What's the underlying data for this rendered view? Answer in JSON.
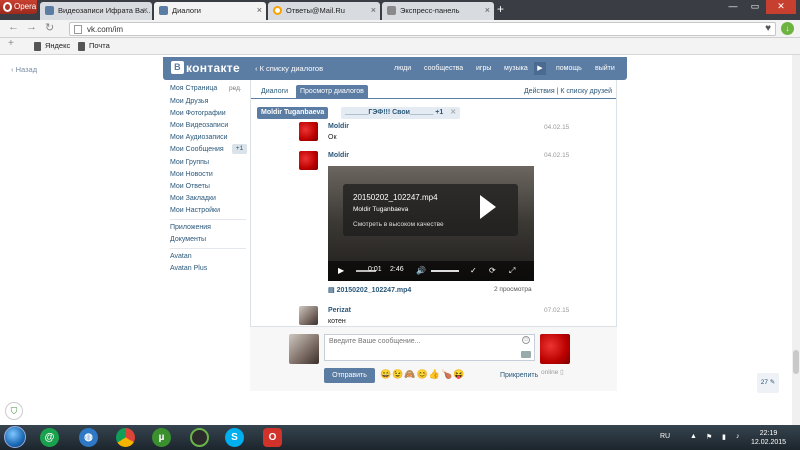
{
  "browser": {
    "menu_label": "Opera",
    "tabs": [
      {
        "title": "Видеозаписи Ифрата Ва...",
        "color": "#5b7ca3"
      },
      {
        "title": "Диалоги",
        "color": "#5b7ca3"
      },
      {
        "title": "Ответы@Mail.Ru",
        "color": "#f7a200"
      },
      {
        "title": "Экспресс-панель",
        "color": "#8a8a8a"
      }
    ],
    "new_tab_glyph": "+",
    "url": "vk.com/im",
    "bookmarks": [
      "Яндекс",
      "Почта"
    ]
  },
  "page": {
    "back_label": "Назад",
    "logo_text": "контакте",
    "logo_letter": "В",
    "back_to_dialogs": "К списку диалогов",
    "top_nav": [
      "люди",
      "сообщества",
      "игры",
      "музыка",
      "помощь",
      "выйти"
    ],
    "left_menu": [
      "Моя Страница",
      "Мои Друзья",
      "Мои Фотографии",
      "Мои Видеозаписи",
      "Мои Аудиозаписи",
      "Мои Сообщения",
      "Мои Группы",
      "Мои Новости",
      "Мои Ответы",
      "Мои Закладки",
      "Мои Настройки"
    ],
    "edit_label": "ред.",
    "messages_badge": "+1",
    "apps_menu": [
      "Приложения",
      "Документы"
    ],
    "extra_menu": [
      "Avatan",
      "Avatan Plus"
    ],
    "view_tabs": [
      "Диалоги",
      "Просмотр диалогов"
    ],
    "actions": "Действия",
    "actions_sep": "|",
    "friends_list": "К списку друзей",
    "dialog_tabs": [
      {
        "label": "Moldir Tuganbaeva"
      },
      {
        "label": "______ГЭФ!!! Свои______",
        "count": "+1"
      }
    ]
  },
  "messages": [
    {
      "sender": "Moldir",
      "text": "Ок",
      "date": "04.02.15"
    },
    {
      "sender": "Moldir",
      "text": "",
      "date": "04.02.15"
    },
    {
      "sender": "Perizat",
      "text": "котен",
      "date": "07.02.15"
    }
  ],
  "video": {
    "title": "20150202_102247.mp4",
    "author": "Moldir Tuganbaeva",
    "hq_link": "Смотреть в высоком качестве",
    "time_current": "0:01",
    "time_total": "2:46",
    "progress": 0.006,
    "file_name": "20150202_102247.mp4",
    "views": "2 просмотра"
  },
  "compose": {
    "placeholder": "Введите Ваше сообщение...",
    "send_label": "Отправить",
    "emoji": "😄😉🙈😊👍🍗😝",
    "attach_label": "Прикрепить",
    "online_label": "online"
  },
  "notifications": {
    "count": "27"
  },
  "taskbar": {
    "language": "RU",
    "time": "22:19",
    "date": "12.02.2015"
  }
}
